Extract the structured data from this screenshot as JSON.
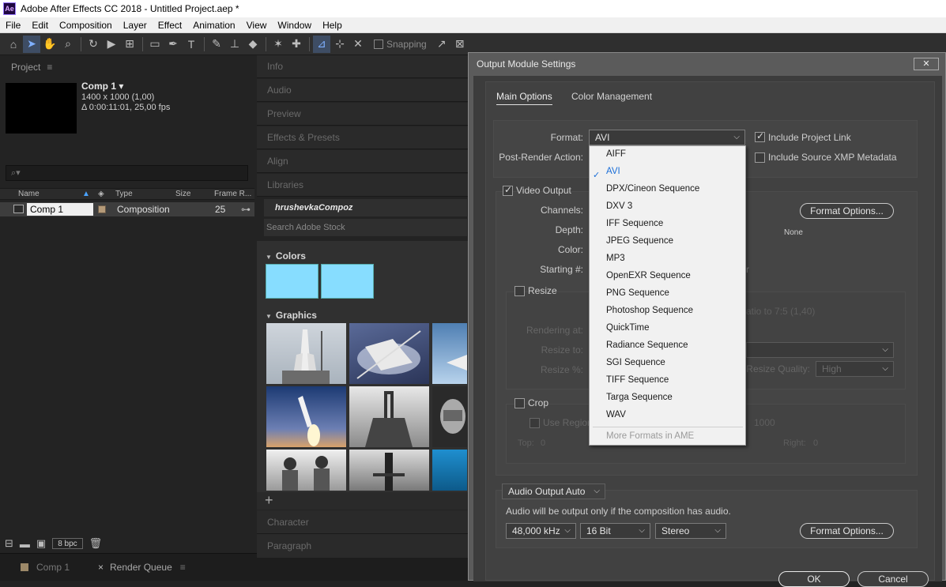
{
  "app": {
    "title": "Adobe After Effects CC 2018 - Untitled Project.aep *",
    "logo": "Ae"
  },
  "menu": [
    "File",
    "Edit",
    "Composition",
    "Layer",
    "Effect",
    "Animation",
    "View",
    "Window",
    "Help"
  ],
  "toolbar": {
    "snapping_label": "Snapping"
  },
  "project": {
    "tab_label": "Project",
    "comp_name": "Comp 1 ▾",
    "comp_res": "1400 x 1000 (1,00)",
    "comp_duration": "Δ 0:00:11:01, 25,00 fps",
    "columns": {
      "name": "Name",
      "type": "Type",
      "size": "Size",
      "frame_rate": "Frame R..."
    },
    "rows": [
      {
        "name": "Comp 1",
        "type": "Composition",
        "frame_rate": "25",
        "swatch": "#b59a78"
      }
    ],
    "bpc": "8 bpc"
  },
  "bottom_tabs": {
    "comp": "Comp 1",
    "render_queue": "Render Queue"
  },
  "panels": [
    "Info",
    "Audio",
    "Preview",
    "Effects & Presets",
    "Align",
    "Libraries"
  ],
  "libraries": {
    "library_name": "hrushevkaCompoz",
    "search_placeholder": "Search Adobe Stock",
    "colors_label": "Colors",
    "graphics_label": "Graphics",
    "swatch_color": "#87ddff",
    "add": "+"
  },
  "lower_panels": [
    "Character",
    "Paragraph"
  ],
  "dialog": {
    "title": "Output Module Settings",
    "close": "✕",
    "tabs": {
      "main": "Main Options",
      "color": "Color Management"
    },
    "format_label": "Format:",
    "format_value": "AVI",
    "post_render_label": "Post-Render Action:",
    "include_project_link": "Include Project Link",
    "include_xmp": "Include Source XMP Metadata",
    "video_output": "Video Output",
    "channels_label": "Channels:",
    "depth_label": "Depth:",
    "color_label": "Color:",
    "starting_label": "Starting #:",
    "format_options": "Format Options...",
    "none": "None",
    "resize": "Resize",
    "ratio_text": "atio to 7:5 (1,40)",
    "rendering_at": "Rendering at:",
    "resize_to": "Resize to:",
    "resize_pct": "Resize %:",
    "resize_quality_label": "Resize Quality:",
    "resize_quality": "High",
    "crop": "Crop",
    "use_region": "Use Region",
    "crop_size": "1000",
    "top_label": "Top:",
    "top_value": "0",
    "right_label": "Right:",
    "right_value": "0",
    "audio_output": "Audio Output Auto",
    "audio_note": "Audio will be output only if the composition has audio.",
    "sample_rate": "48,000 kHz",
    "bit_depth": "16 Bit",
    "channels_audio": "Stereo",
    "audio_format_options": "Format Options...",
    "ok": "OK",
    "cancel": "Cancel",
    "starting_tail": "r"
  },
  "format_list": {
    "items": [
      "AIFF",
      "AVI",
      "DPX/Cineon Sequence",
      "DXV 3",
      "IFF Sequence",
      "JPEG Sequence",
      "MP3",
      "OpenEXR Sequence",
      "PNG Sequence",
      "Photoshop Sequence",
      "QuickTime",
      "Radiance Sequence",
      "SGI Sequence",
      "TIFF Sequence",
      "Targa Sequence",
      "WAV"
    ],
    "selected": "AVI",
    "more": "More Formats in AME"
  }
}
